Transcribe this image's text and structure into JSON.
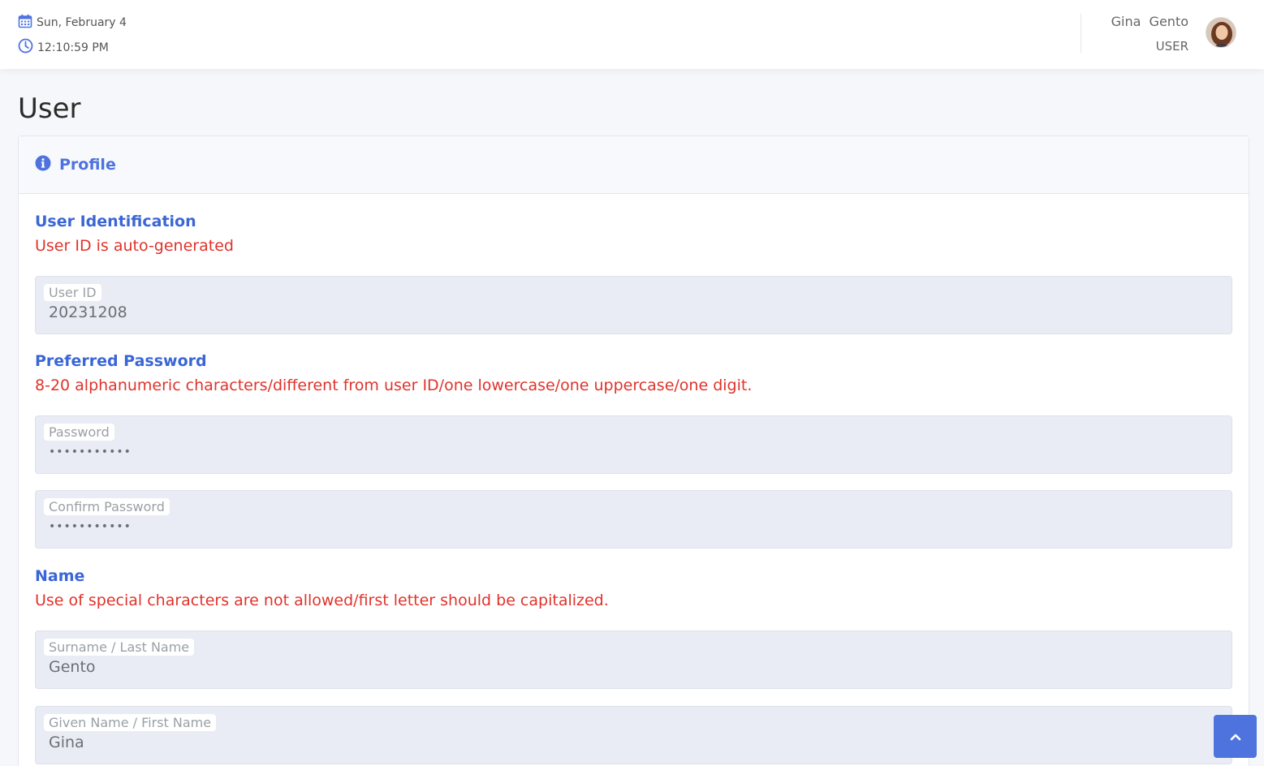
{
  "header": {
    "date": "Sun, February 4",
    "time": "12:10:59 PM",
    "user_name": "Gina  Gento",
    "user_role": "USER"
  },
  "page": {
    "title": "User"
  },
  "card": {
    "title": "Profile"
  },
  "sections": {
    "identification": {
      "title": "User Identification",
      "note": "User ID is auto-generated"
    },
    "password": {
      "title": "Preferred Password",
      "note": "8-20 alphanumeric characters/different from user ID/one lowercase/one uppercase/one digit."
    },
    "name": {
      "title": "Name",
      "note": "Use of special characters are not allowed/first letter should be capitalized."
    }
  },
  "fields": {
    "user_id": {
      "label": "User ID",
      "value": "20231208"
    },
    "password": {
      "label": "Password",
      "value": "•••••••••••"
    },
    "confirm_password": {
      "label": "Confirm Password",
      "value": "•••••••••••"
    },
    "surname": {
      "label": "Surname / Last Name",
      "value": "Gento"
    },
    "given_name": {
      "label": "Given Name / First Name",
      "value": "Gina"
    }
  },
  "colors": {
    "accent": "#4e73df",
    "warning": "#e0332b"
  },
  "icons": {
    "date": "calendar-icon",
    "time": "clock-icon",
    "profile": "info-circle-icon",
    "scroll_top": "chevron-up-icon"
  }
}
